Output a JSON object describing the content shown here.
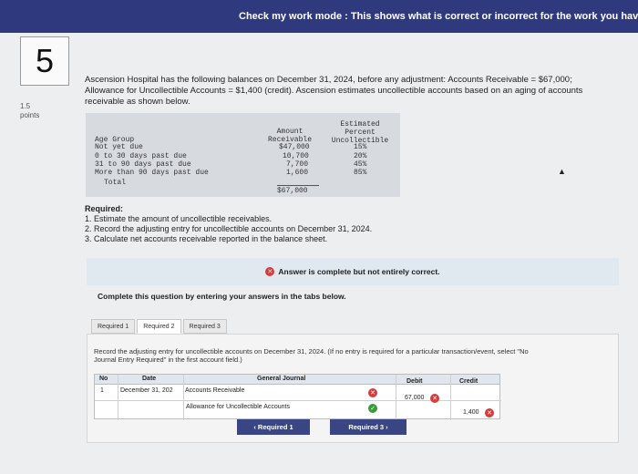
{
  "topbar": {
    "text": "Check my work mode : This shows what is correct or incorrect for the work you have completed s"
  },
  "question": {
    "number": "5",
    "points_value": "1.5",
    "points_label": "points"
  },
  "intro": {
    "text": "Ascension Hospital has the following balances on December 31, 2024, before any adjustment: Accounts Receivable = $67,000; Allowance for Uncollectible Accounts = $1,400 (credit). Ascension estimates uncollectible accounts based on an aging of accounts receivable as shown below."
  },
  "aging_table": {
    "headers": {
      "age_group": "Age Group",
      "amount_l1": "Amount",
      "amount_l2": "Receivable",
      "est_l1": "Estimated",
      "est_l2": "Percent",
      "est_l3": "Uncollectible"
    },
    "rows": [
      {
        "age": "Not yet due",
        "amount": "$47,000",
        "percent": "15%"
      },
      {
        "age": "0 to 30 days past due",
        "amount": "10,700",
        "percent": "20%"
      },
      {
        "age": "31 to 90 days past due",
        "amount": "7,700",
        "percent": "45%"
      },
      {
        "age": "More than 90 days past due",
        "amount": "1,600",
        "percent": "85%"
      }
    ],
    "total": {
      "label": "Total",
      "amount": "$67,000"
    }
  },
  "required": {
    "title": "Required:",
    "items": [
      "1. Estimate the amount of uncollectible receivables.",
      "2. Record the adjusting entry for uncollectible accounts on December 31, 2024.",
      "3. Calculate net accounts receivable reported in the balance sheet."
    ]
  },
  "answer_banner": {
    "text": "Answer is complete but not entirely correct."
  },
  "instructions": {
    "text": "Complete this question by entering your answers in the tabs below."
  },
  "tabs": [
    {
      "label": "Required 1"
    },
    {
      "label": "Required 2"
    },
    {
      "label": "Required 3"
    }
  ],
  "record_text": "Record the adjusting entry for uncollectible accounts on December 31, 2024. (If no entry is required for a particular transaction/event, select \"No Journal Entry Required\" in the first account field.)",
  "journal": {
    "headers": {
      "no": "No",
      "date": "Date",
      "general_journal": "General Journal",
      "debit": "Debit",
      "credit": "Credit"
    },
    "rows": [
      {
        "no": "1",
        "date": "December 31, 202",
        "account": "Accounts Receivable",
        "debit": "67,000",
        "credit": "",
        "status": "incorrect"
      },
      {
        "no": "",
        "date": "",
        "account": "Allowance for Uncollectible Accounts",
        "debit": "",
        "credit": "1,400",
        "status": "correct"
      }
    ]
  },
  "nav": {
    "prev_label": "Required 1",
    "next_label": "Required 3"
  },
  "colors": {
    "topbar": "#2f3a7e",
    "incorrect": "#d43c3c",
    "correct": "#3a9a3a",
    "nav_button": "#3a4684"
  }
}
